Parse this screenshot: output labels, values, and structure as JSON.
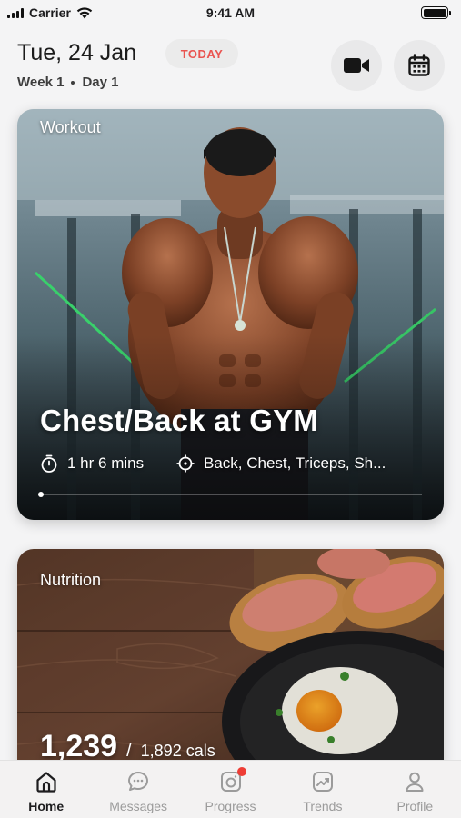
{
  "status_bar": {
    "carrier": "Carrier",
    "time": "9:41 AM"
  },
  "header": {
    "date": "Tue, 24 Jan",
    "today_badge": "TODAY",
    "week": "Week 1",
    "day": "Day 1",
    "icons": [
      "video-camera-icon",
      "calendar-icon"
    ]
  },
  "workout_card": {
    "label": "Workout",
    "title": "Chest/Back at GYM",
    "duration": "1 hr 6 mins",
    "muscles": "Back, Chest, Triceps, Sh...",
    "progress": 0
  },
  "nutrition_card": {
    "label": "Nutrition",
    "calories_consumed": "1,239",
    "separator": "/",
    "calories_goal": "1,892 cals"
  },
  "tabs": [
    {
      "label": "Home",
      "icon": "home-icon",
      "active": true
    },
    {
      "label": "Messages",
      "icon": "chat-bubble-icon",
      "active": false
    },
    {
      "label": "Progress",
      "icon": "camera-icon",
      "active": false,
      "notification": true
    },
    {
      "label": "Trends",
      "icon": "trend-chart-icon",
      "active": false
    },
    {
      "label": "Profile",
      "icon": "user-icon",
      "active": false
    }
  ],
  "colors": {
    "today_text": "#ea5450",
    "notification_dot": "#ee3d35",
    "active_tab": "#1d1d1f",
    "inactive_tab": "#9b9b9b"
  }
}
